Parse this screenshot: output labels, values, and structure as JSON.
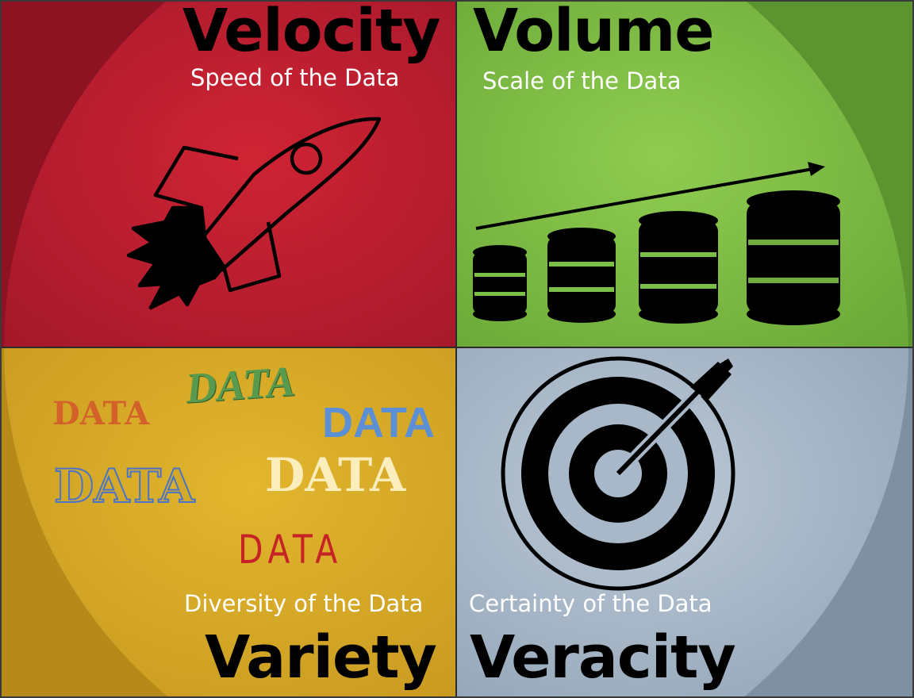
{
  "quadrants": {
    "velocity": {
      "title": "Velocity",
      "subtitle": "Speed of the Data",
      "icon": "rocket-icon",
      "color": "#c81e2c"
    },
    "volume": {
      "title": "Volume",
      "subtitle": "Scale of the Data",
      "icon": "database-growth-icon",
      "color": "#7cc043"
    },
    "variety": {
      "title": "Variety",
      "subtitle": "Diversity of the Data",
      "icon": "data-words",
      "color": "#d4a928"
    },
    "veracity": {
      "title": "Veracity",
      "subtitle": "Certainty of the Data",
      "icon": "target-arrow-icon",
      "color": "#a9b8c8"
    }
  },
  "variety_words": [
    {
      "text": "DATA",
      "color": "#d2622a",
      "style": "serif-bold"
    },
    {
      "text": "DATA",
      "color": "#5a9a4e",
      "style": "script-italic"
    },
    {
      "text": "DATA",
      "color": "#5b8fd6",
      "style": "sans-bold"
    },
    {
      "text": "DATA",
      "color": "#4a74c9",
      "style": "outline"
    },
    {
      "text": "DATA",
      "color": "#fbeebc",
      "style": "slab"
    },
    {
      "text": "DATA",
      "color": "#c62326",
      "style": "condensed"
    }
  ]
}
